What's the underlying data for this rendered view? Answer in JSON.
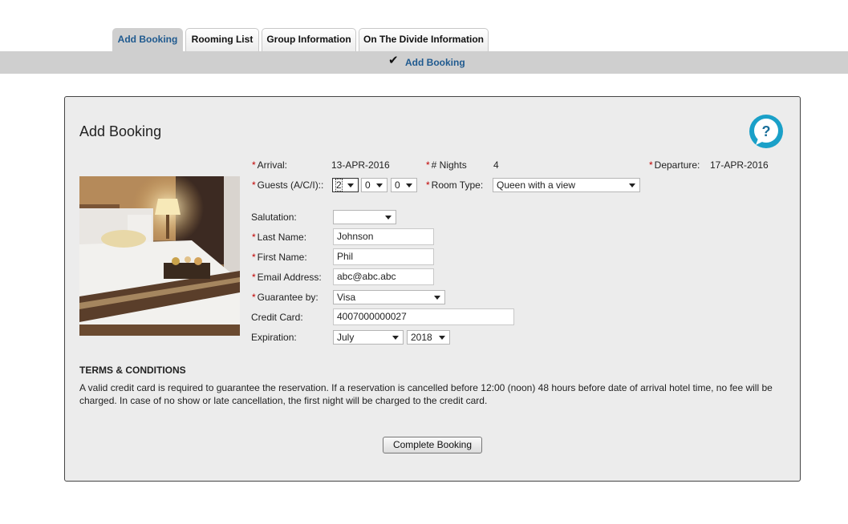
{
  "tabs": [
    {
      "label": "Add Booking",
      "active": true
    },
    {
      "label": "Rooming List"
    },
    {
      "label": "Group Information"
    },
    {
      "label": "On The Divide Information"
    }
  ],
  "subnav": {
    "checkmark": "✔",
    "label": "Add Booking"
  },
  "panel": {
    "title": "Add Booking",
    "help_icon": "question-chat-icon",
    "required_marker": "*",
    "arrival": {
      "label": "Arrival:",
      "value": "13-APR-2016"
    },
    "nights": {
      "label": "# Nights",
      "value": "4"
    },
    "departure": {
      "label": "Departure:",
      "value": "17-APR-2016"
    },
    "guests": {
      "label": "Guests (A/C/I)::",
      "adults": "2",
      "children": "0",
      "infants": "0"
    },
    "room_type": {
      "label": "Room Type:",
      "value": "Queen with a view"
    },
    "salutation": {
      "label": "Salutation:",
      "value": ""
    },
    "last_name": {
      "label": "Last Name:",
      "value": "Johnson"
    },
    "first_name": {
      "label": "First Name:",
      "value": "Phil"
    },
    "email": {
      "label": "Email Address:",
      "value": "abc@abc.abc"
    },
    "guarantee": {
      "label": "Guarantee by:",
      "value": "Visa"
    },
    "credit_card": {
      "label": "Credit Card:",
      "value": "4007000000027"
    },
    "expiration": {
      "label": "Expiration:",
      "month": "July",
      "year": "2018"
    },
    "terms_title": "TERMS & CONDITIONS",
    "terms_text": "A valid credit card is required to guarantee the reservation. If a reservation is cancelled before 12:00 (noon) 48 hours before date of arrival hotel time, no fee will be charged. In case of no show or late cancellation, the first night will be charged to the credit card.",
    "submit_label": "Complete Booking"
  },
  "colors": {
    "accent": "#1f5a8f",
    "required": "#c00000",
    "help": "#1aa0c8"
  }
}
